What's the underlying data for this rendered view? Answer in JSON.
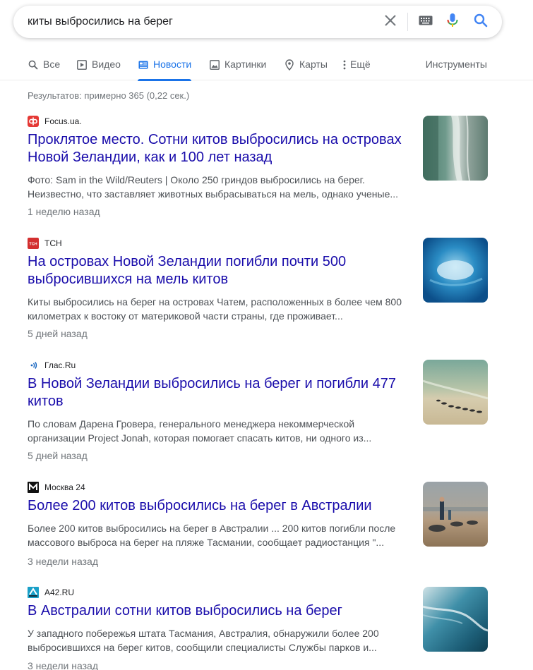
{
  "search": {
    "query": "киты выбросились на берег"
  },
  "tabs": [
    {
      "label": "Все",
      "icon": "search-icon"
    },
    {
      "label": "Видео",
      "icon": "play-icon"
    },
    {
      "label": "Новости",
      "icon": "news-icon",
      "active": true
    },
    {
      "label": "Картинки",
      "icon": "image-icon"
    },
    {
      "label": "Карты",
      "icon": "map-pin-icon"
    },
    {
      "label": "Ещё",
      "icon": "more-vert-icon"
    }
  ],
  "tools_label": "Инструменты",
  "result_stats": "Результатов: примерно 365 (0,22 сек.)",
  "results": [
    {
      "source": "Focus.ua.",
      "favicon": "focus-favicon-icon",
      "title": "Проклятое место. Сотни китов выбросились на островах Новой Зеландии, как и 100 лет назад",
      "snippet": "Фото: Sam in the Wild/Reuters | Около 250 гриндов выбросились на берег. Неизвестно, что заставляет животных выбрасываться на мель, однако ученые...",
      "time": "1 неделю назад"
    },
    {
      "source": "ТСН",
      "favicon": "tsn-favicon-icon",
      "title": "На островах Новой Зеландии погибли почти 500 выбросившихся на мель китов",
      "snippet": "Киты выбросились на берег на островах Чатем, расположенных в более чем 800 километрах к востоку от материковой части страны, где проживает...",
      "time": "5 дней назад"
    },
    {
      "source": "Глас.Ru",
      "favicon": "glas-favicon-icon",
      "title": "В Новой Зеландии выбросились на берег и погибли 477 китов",
      "snippet": "По словам Дарена Гровера, генерального менеджера некоммерческой организации Project Jonah, которая помогает спасать китов, ни одного из...",
      "time": "5 дней назад"
    },
    {
      "source": "Москва 24",
      "favicon": "moskva24-favicon-icon",
      "title": "Более 200 китов выбросились на берег в Австралии",
      "snippet": "Более 200 китов выбросились на берег в Австралии ... 200 китов погибли после массового выброса на берег на пляже Тасмании, сообщает радиостанция \"...",
      "time": "3 недели назад"
    },
    {
      "source": "A42.RU",
      "favicon": "a42-favicon-icon",
      "title": "В Австралии сотни китов выбросились на берег",
      "snippet": "У западного побережья штата Тасмания, Австралия, обнаружили более 200 выбросившихся на берег китов, сообщили специалисты Службы парков и...",
      "time": "3 недели назад"
    }
  ],
  "colors": {
    "link": "#1a0dab",
    "accent": "#1a73e8",
    "muted": "#70757a",
    "snippet": "#4d5156"
  }
}
